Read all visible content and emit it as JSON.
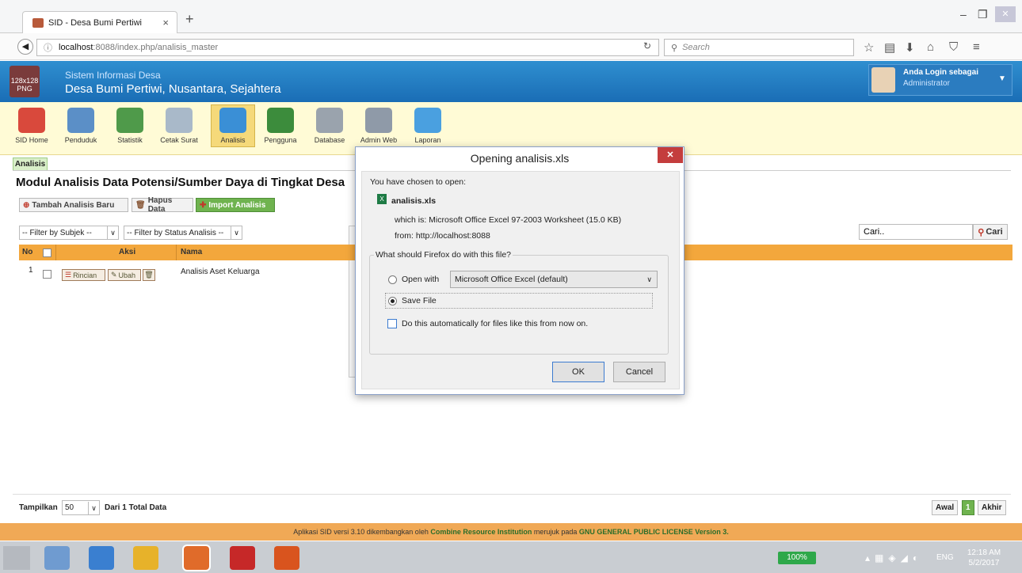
{
  "browser": {
    "tab_title": "SID - Desa Bumi Pertiwi",
    "tab_close": "×",
    "new_tab": "+",
    "url_host": "localhost",
    "url_rest": ":8088/index.php/analisis_master",
    "search_placeholder": "Search"
  },
  "header": {
    "logo_text": "128x128 PNG",
    "system_name": "Sistem Informasi Desa",
    "village_name": "Desa Bumi Pertiwi, Nusantara, Sejahtera",
    "login_label": "Anda Login sebagai",
    "role": "Administrator"
  },
  "toolbar": {
    "items": [
      {
        "label": "SID Home",
        "color": "#d9493c"
      },
      {
        "label": "Penduduk",
        "color": "#5b8fc7"
      },
      {
        "label": "Statistik",
        "color": "#4f9a4a"
      },
      {
        "label": "Cetak Surat",
        "color": "#a9b9c9"
      },
      {
        "label": "Analisis",
        "color": "#3a8fd6"
      },
      {
        "label": "Pengguna",
        "color": "#3c8c3c"
      },
      {
        "label": "Database",
        "color": "#9aa3ad"
      },
      {
        "label": "Admin Web",
        "color": "#8f9aa8"
      },
      {
        "label": "Laporan",
        "color": "#4aa0e0"
      }
    ]
  },
  "content": {
    "tab": "Analisis",
    "title": "Modul Analisis Data Potensi/Sumber Daya di Tingkat Desa",
    "btn_add": "Tambah Analisis Baru",
    "btn_delete": "Hapus Data",
    "btn_import": "Import Analisis",
    "filter_subject": "-- Filter by Subjek --",
    "filter_status": "-- Filter by Status Analisis --",
    "search_value": "Cari..",
    "search_btn": "Cari",
    "columns": {
      "no": "No",
      "aksi": "Aksi",
      "nama": "Nama"
    },
    "rows": [
      {
        "no": "1",
        "detail": "Rincian",
        "edit": "Ubah",
        "name": "Analisis Aset Keluarga"
      }
    ],
    "show_label": "Tampilkan",
    "show_count": "50",
    "total_label": "Dari 1 Total Data",
    "pg_first": "Awal",
    "pg_current": "1",
    "pg_last": "Akhir"
  },
  "footer": {
    "pre": "Aplikasi SID versi 3.10 dikembangkan oleh ",
    "org": "Combine Resource Institution",
    "mid": " merujuk pada ",
    "license": "GNU GENERAL PUBLIC LICENSE Version 3."
  },
  "dialog": {
    "title": "Opening analisis.xls",
    "chosen": "You have chosen to open:",
    "filename": "analisis.xls",
    "which_is": "which is: Microsoft Office Excel 97-2003 Worksheet (15.0 KB)",
    "from": "from: http://localhost:8088",
    "question": "What should Firefox do with this file?",
    "open_with": "Open with",
    "app": "Microsoft Office Excel (default)",
    "save_file": "Save File",
    "auto": "Do this automatically for files like this from now on.",
    "ok": "OK",
    "cancel": "Cancel"
  },
  "taskbar": {
    "battery": "100%",
    "lang": "ENG",
    "time": "12:18 AM",
    "date": "5/2/2017"
  }
}
